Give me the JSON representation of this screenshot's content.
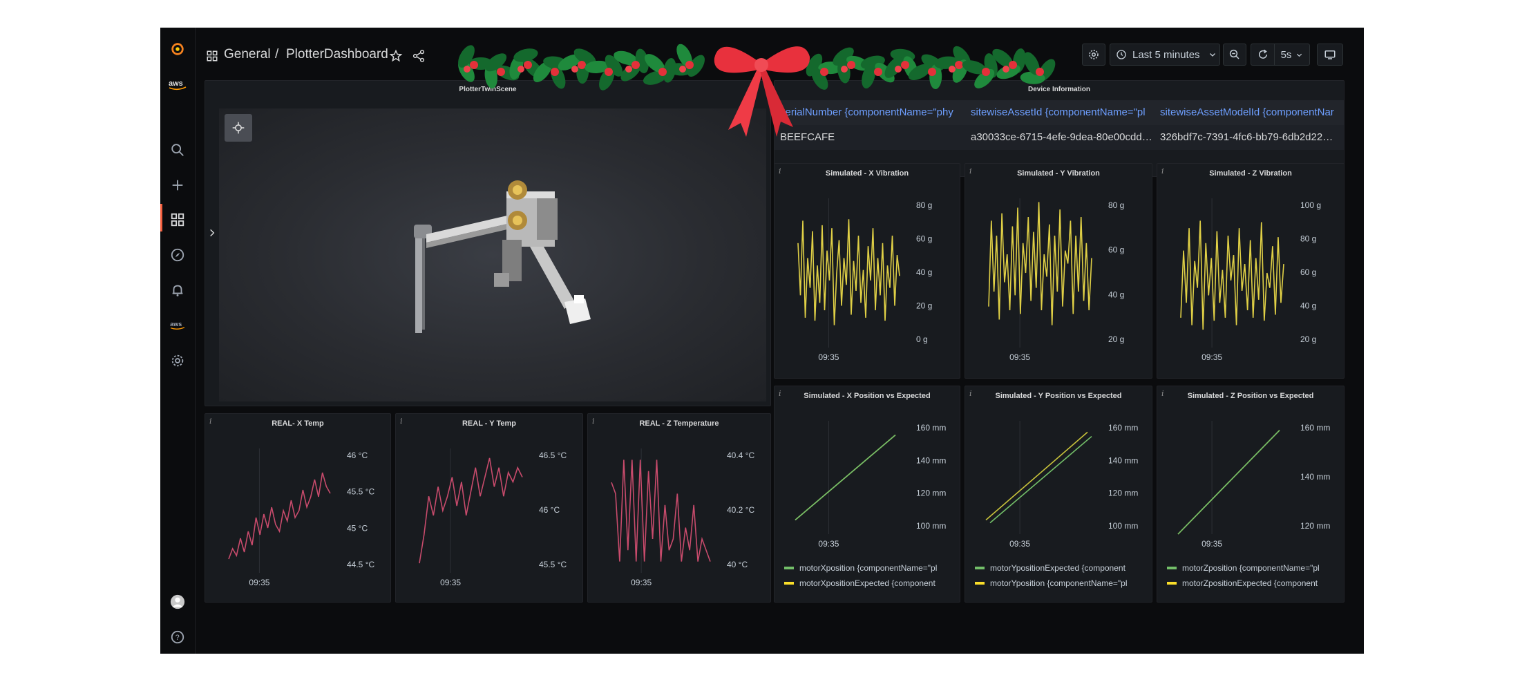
{
  "breadcrumb": {
    "folder": "General",
    "separator": "/",
    "dashboard": "PlotterDashboard"
  },
  "toolbar": {
    "time_range": "Last 5 minutes",
    "refresh_interval": "5s"
  },
  "icons": {
    "logo": "grafana-logo-icon",
    "aws": "aws-logo-icon",
    "search": "search-icon",
    "add": "plus-icon",
    "dashboards": "dashboards-icon",
    "explore": "compass-icon",
    "alerting": "bell-icon",
    "config": "gear-icon",
    "help": "help-icon",
    "star": "star-icon",
    "share": "share-icon",
    "clock": "clock-icon",
    "zoom_out": "zoom-out-icon",
    "refresh": "refresh-icon",
    "settings": "settings-icon",
    "tv": "tv-mode-icon"
  },
  "colors": {
    "background": "#0b0c0e",
    "panel": "#181b1f",
    "vibration_series": "#e0d046",
    "temp_series": "#c84b6c",
    "legend_green": "#73bf69",
    "legend_yellow": "#fade2a",
    "header_blue": "#6e9fff"
  },
  "scene": {
    "title": "PlotterTwinScene"
  },
  "device": {
    "title": "Device Information",
    "columns": [
      "serialNumber {componentName=\"phy",
      "sitewiseAssetId {componentName=\"pl",
      "sitewiseAssetModelId {componentNar"
    ],
    "rows": [
      [
        "BEEFCAFE",
        "a30033ce-6715-4efe-9dea-80e00cdd…",
        "326bdf7c-7391-4fc6-bb79-6db2d22…"
      ]
    ]
  },
  "panels": {
    "vib_x": {
      "title": "Simulated - X Vibration",
      "time": "09:35",
      "ticks": [
        "80 g",
        "60 g",
        "40 g",
        "20 g",
        "0 g"
      ]
    },
    "vib_y": {
      "title": "Simulated - Y Vibration",
      "time": "09:35",
      "ticks": [
        "80 g",
        "60 g",
        "40 g",
        "20 g"
      ]
    },
    "vib_z": {
      "title": "Simulated - Z Vibration",
      "time": "09:35",
      "ticks": [
        "100 g",
        "80 g",
        "60 g",
        "40 g",
        "20 g"
      ]
    },
    "pos_x": {
      "title": "Simulated - X Position vs Expected",
      "time": "09:35",
      "ticks": [
        "160 mm",
        "140 mm",
        "120 mm",
        "100 mm"
      ],
      "legend": [
        "motorXposition {componentName=\"pl",
        "motorXpositionExpected {component"
      ]
    },
    "pos_y": {
      "title": "Simulated - Y Position vs Expected",
      "time": "09:35",
      "ticks": [
        "160 mm",
        "140 mm",
        "120 mm",
        "100 mm"
      ],
      "legend": [
        "motorYpositionExpected {component",
        "motorYposition {componentName=\"pl"
      ]
    },
    "pos_z": {
      "title": "Simulated - Z Position vs Expected",
      "time": "09:35",
      "ticks": [
        "160 mm",
        "140 mm",
        "120 mm"
      ],
      "legend": [
        "motorZposition {componentName=\"pl",
        "motorZpositionExpected {component"
      ]
    },
    "temp_x": {
      "title": "REAL- X Temp",
      "time": "09:35",
      "ticks": [
        "46 °C",
        "45.5 °C",
        "45 °C",
        "44.5 °C"
      ]
    },
    "temp_y": {
      "title": "REAL - Y Temp",
      "time": "09:35",
      "ticks": [
        "46.5 °C",
        "46 °C",
        "45.5 °C"
      ]
    },
    "temp_z": {
      "title": "REAL - Z Temperature",
      "time": "09:35",
      "ticks": [
        "40.4 °C",
        "40.2 °C",
        "40 °C"
      ]
    }
  },
  "chart_data": [
    {
      "type": "line",
      "title": "Simulated - X Vibration",
      "ylabel": "g",
      "ylim": [
        0,
        100
      ],
      "x": "time (09:35 window)",
      "series": [
        {
          "values": [
            70,
            35,
            85,
            20,
            60,
            40,
            78,
            18,
            55,
            30,
            82,
            25,
            65,
            45,
            80,
            15,
            50,
            72,
            28,
            60,
            42,
            86,
            22,
            58,
            38,
            75,
            30,
            52,
            20,
            68,
            45,
            80,
            25,
            60,
            35,
            70,
            18,
            55,
            40,
            75,
            28,
            62,
            48
          ]
        }
      ]
    },
    {
      "type": "line",
      "title": "Simulated - Y Vibration",
      "ylabel": "g",
      "ylim": [
        10,
        90
      ],
      "x": "time (09:35 window)",
      "series": [
        {
          "values": [
            32,
            78,
            40,
            70,
            25,
            82,
            45,
            60,
            30,
            75,
            38,
            85,
            28,
            66,
            50,
            80,
            35,
            72,
            42,
            88,
            30,
            60,
            48,
            76,
            22,
            70,
            40,
            84,
            32,
            62,
            55,
            78,
            28,
            70,
            40,
            80,
            35,
            66,
            30,
            58
          ]
        }
      ]
    },
    {
      "type": "line",
      "title": "Simulated - Z Vibration",
      "ylabel": "g",
      "ylim": [
        10,
        110
      ],
      "x": "time (09:35 window)",
      "series": [
        {
          "values": [
            30,
            75,
            40,
            90,
            25,
            68,
            50,
            95,
            22,
            80,
            45,
            70,
            28,
            88,
            40,
            62,
            30,
            85,
            55,
            72,
            25,
            90,
            48,
            66,
            35,
            82,
            30,
            70,
            42,
            94,
            28,
            60,
            50,
            78,
            32,
            84,
            40,
            66
          ]
        }
      ]
    },
    {
      "type": "line",
      "title": "Simulated - X Position vs Expected",
      "ylabel": "mm",
      "ylim": [
        90,
        170
      ],
      "series": [
        {
          "name": "motorXposition {componentName=\"pl",
          "values": [
            100,
            160
          ]
        },
        {
          "name": "motorXpositionExpected {component",
          "values": [
            100,
            160
          ]
        }
      ]
    },
    {
      "type": "line",
      "title": "Simulated - Y Position vs Expected",
      "ylabel": "mm",
      "ylim": [
        90,
        170
      ],
      "series": [
        {
          "name": "motorYpositionExpected {component",
          "values": [
            100,
            162
          ]
        },
        {
          "name": "motorYposition {componentName=\"pl",
          "values": [
            98,
            159
          ]
        }
      ]
    },
    {
      "type": "line",
      "title": "Simulated - Z Position vs Expected",
      "ylabel": "mm",
      "ylim": [
        110,
        170
      ],
      "series": [
        {
          "name": "motorZposition {componentName=\"pl",
          "values": [
            110,
            165
          ]
        },
        {
          "name": "motorZpositionExpected {component",
          "values": [
            110,
            165
          ]
        }
      ]
    },
    {
      "type": "line",
      "title": "REAL- X Temp",
      "ylabel": "°C",
      "ylim": [
        44.4,
        46.2
      ],
      "series": [
        {
          "values": [
            44.6,
            44.75,
            44.65,
            44.9,
            44.7,
            45.0,
            44.8,
            45.2,
            44.95,
            45.25,
            45.05,
            45.35,
            45.1,
            45.0,
            45.3,
            45.15,
            45.45,
            45.2,
            45.3,
            45.6,
            45.35,
            45.5,
            45.75,
            45.5,
            45.85,
            45.65,
            45.55
          ]
        }
      ]
    },
    {
      "type": "line",
      "title": "REAL - Y Temp",
      "ylabel": "°C",
      "ylim": [
        45.4,
        46.7
      ],
      "series": [
        {
          "values": [
            45.5,
            45.8,
            46.2,
            46.0,
            46.3,
            46.05,
            46.2,
            46.4,
            46.1,
            46.35,
            46.0,
            46.25,
            46.5,
            46.2,
            46.4,
            46.6,
            46.3,
            46.5,
            46.2,
            46.45,
            46.35,
            46.5,
            46.4
          ]
        }
      ]
    },
    {
      "type": "line",
      "title": "REAL - Z Temperature",
      "ylabel": "°C",
      "ylim": [
        39.95,
        40.5
      ],
      "series": [
        {
          "values": [
            40.35,
            40.3,
            40.0,
            40.45,
            40.05,
            40.45,
            40.0,
            40.45,
            40.0,
            40.4,
            40.1,
            40.45,
            40.0,
            40.25,
            40.05,
            40.1,
            40.3,
            40.0,
            40.15,
            40.05,
            40.25,
            40.0,
            40.1,
            40.05,
            40.0
          ]
        }
      ]
    }
  ]
}
